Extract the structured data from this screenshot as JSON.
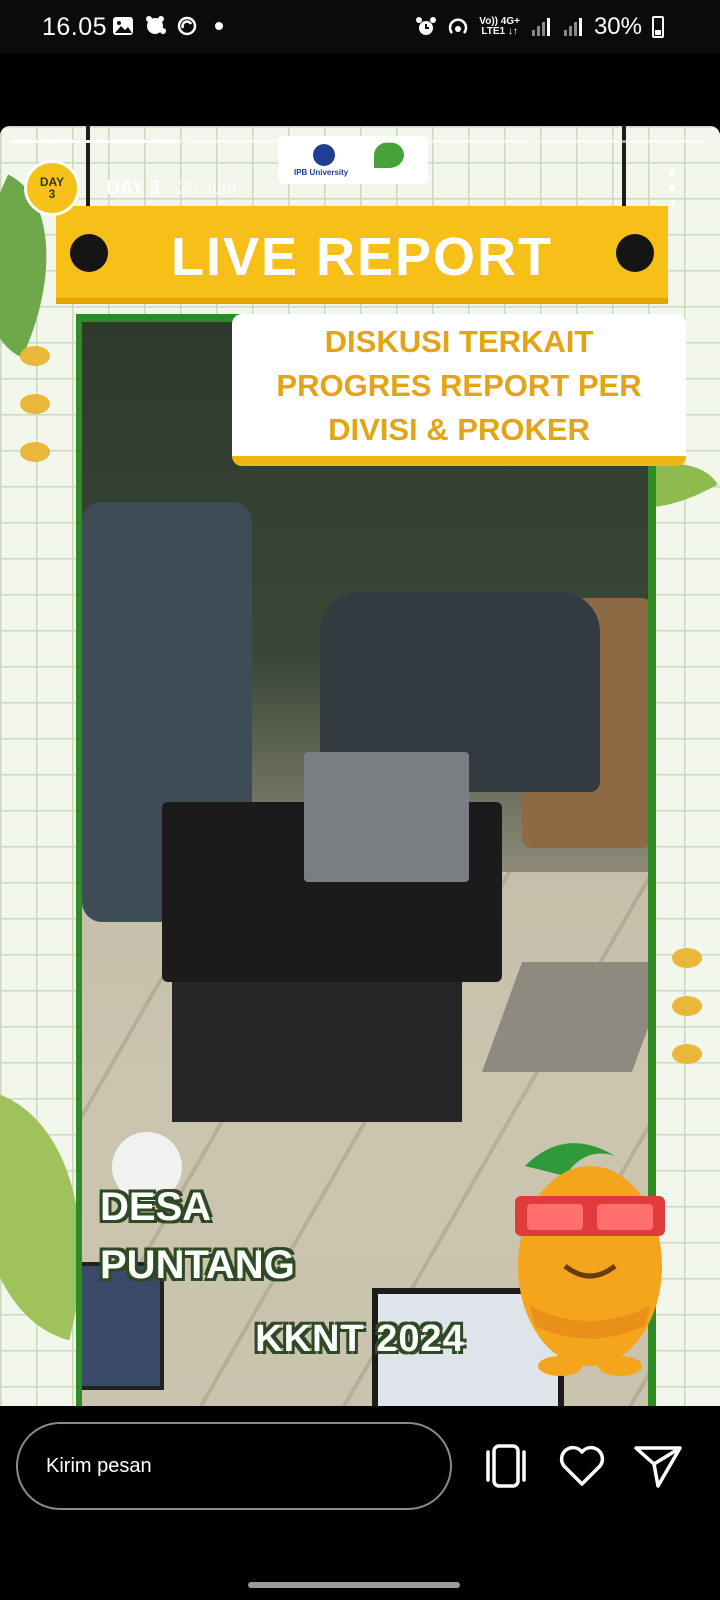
{
  "status_bar": {
    "time": "16.05",
    "network_label_top": "Vo)) 4G+",
    "network_label_bottom": "LTE1 ↓↑",
    "battery": "30%"
  },
  "story": {
    "username": "DAY 3",
    "date": "26 Juni",
    "avatar_line1": "DAY",
    "avatar_line2": "3",
    "logo_text": "IPB University",
    "banner_title": "LIVE REPORT",
    "subtitle_line1": "DISKUSI TERKAIT",
    "subtitle_line2": "PROGRES REPORT PER",
    "subtitle_line3": "DIVISI & PROKER",
    "location_line1": "DESA",
    "location_line2": "PUNTANG",
    "event": "KKNT 2024",
    "progress_segments": 4,
    "active_segment": 1
  },
  "bottom_bar": {
    "message_placeholder": "Kirim pesan",
    "icons": [
      "layers-icon",
      "heart-icon",
      "send-icon"
    ]
  },
  "colors": {
    "banner_yellow": "#f6c019",
    "subtitle_text": "#e4a514",
    "frame_green": "#2f8b24"
  }
}
